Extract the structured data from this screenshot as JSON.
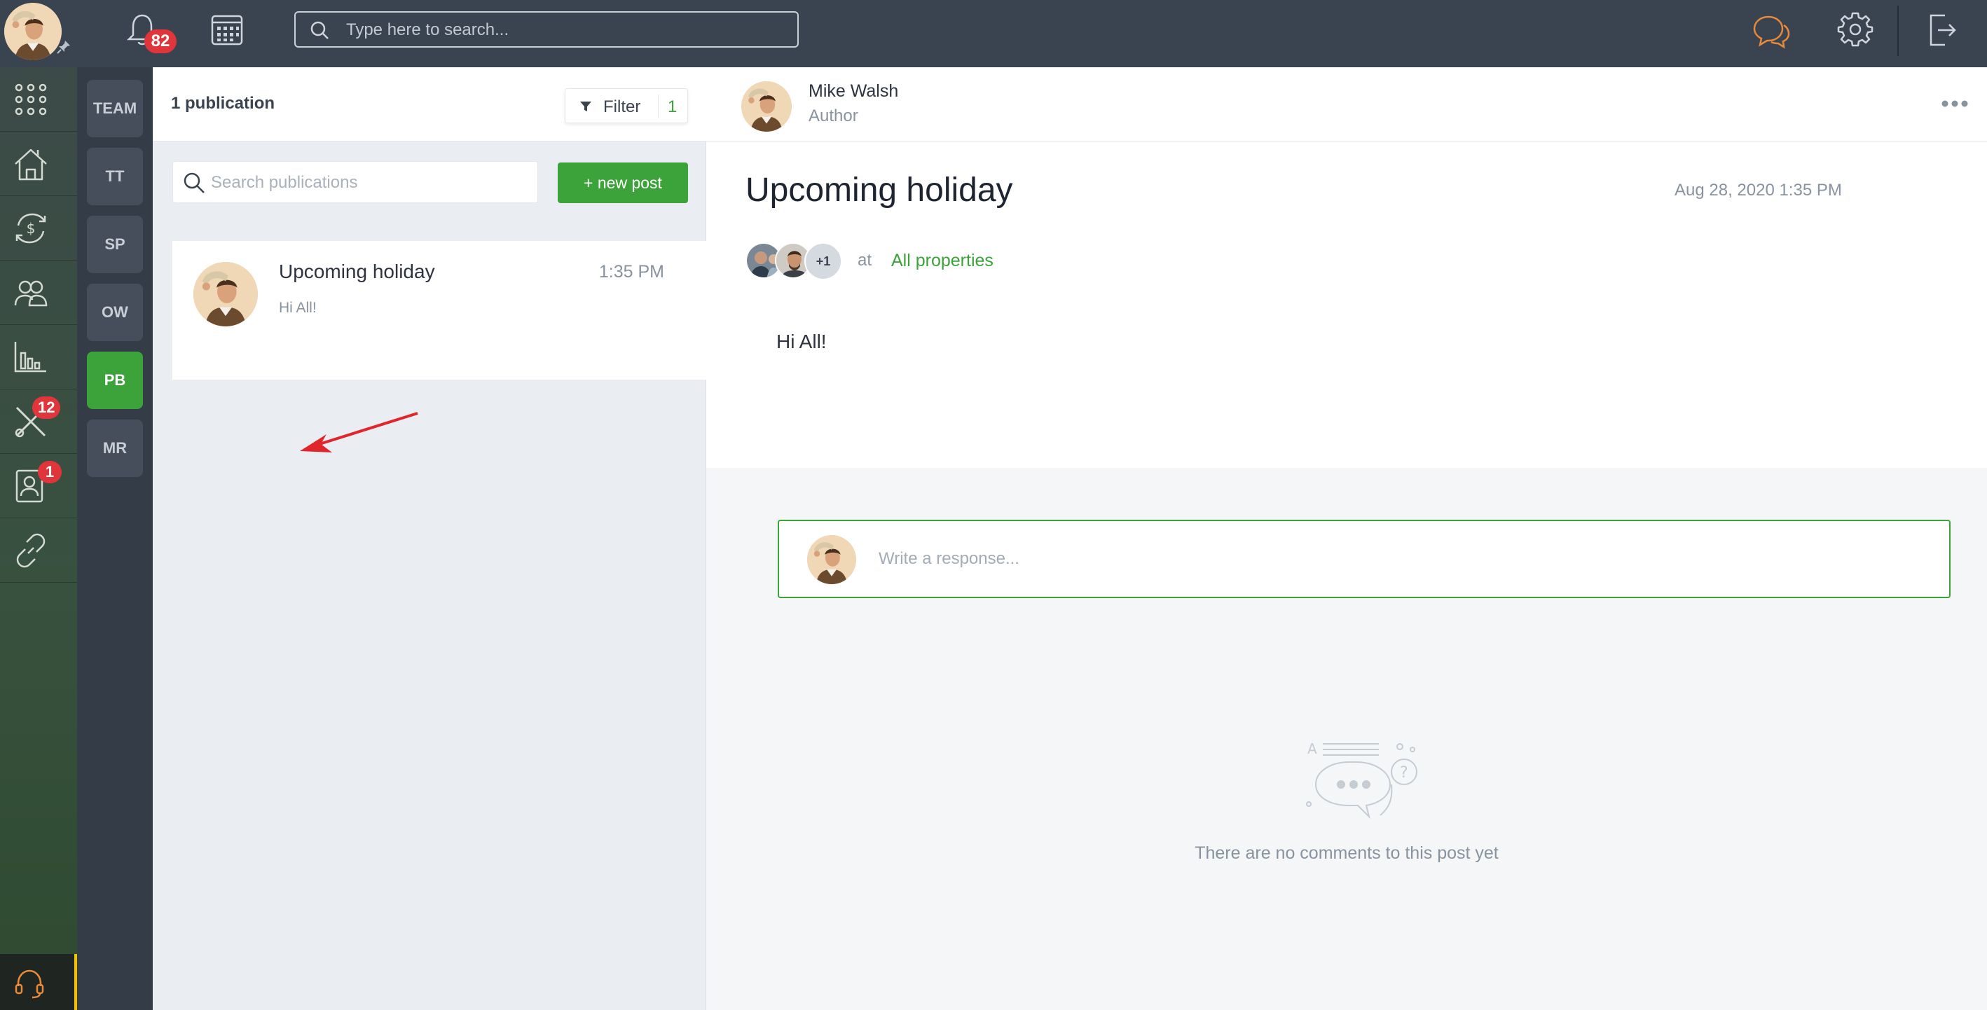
{
  "topbar": {
    "notifications_count": "82",
    "search_placeholder": "Type here to search..."
  },
  "leftrail": {
    "items": [
      {
        "icon": "apps-grid-icon"
      },
      {
        "icon": "properties-icon"
      },
      {
        "icon": "finance-icon"
      },
      {
        "icon": "people-icon"
      },
      {
        "icon": "reports-icon"
      },
      {
        "icon": "maintenance-icon",
        "badge": "12"
      },
      {
        "icon": "contacts-icon",
        "badge": "1"
      },
      {
        "icon": "links-icon"
      }
    ],
    "support_icon": "headset-icon"
  },
  "teams": [
    {
      "label": "TEAM",
      "active": false
    },
    {
      "label": "TT",
      "active": false
    },
    {
      "label": "SP",
      "active": false
    },
    {
      "label": "OW",
      "active": false
    },
    {
      "label": "PB",
      "active": true
    },
    {
      "label": "MR",
      "active": false
    }
  ],
  "publications": {
    "count_label": "1 publication",
    "filter_label": "Filter",
    "filter_count": "1",
    "search_placeholder": "Search publications",
    "new_post_label": "+ new post",
    "items": [
      {
        "title": "Upcoming holiday",
        "time": "1:35 PM",
        "excerpt": "Hi All!"
      }
    ]
  },
  "post": {
    "author_name": "Mike Walsh",
    "author_role": "Author",
    "title": "Upcoming holiday",
    "date": "Aug 28, 2020 1:35 PM",
    "recipients_more": "+1",
    "at_label": "at",
    "property_link": "All properties",
    "body": "Hi All!",
    "response_placeholder": "Write a response...",
    "empty_comments": "There are no comments to this post yet"
  },
  "colors": {
    "accent_green": "#3ba339",
    "topbar": "#3a4350",
    "badge_red": "#e0363b",
    "chat_orange": "#e88a3a"
  }
}
